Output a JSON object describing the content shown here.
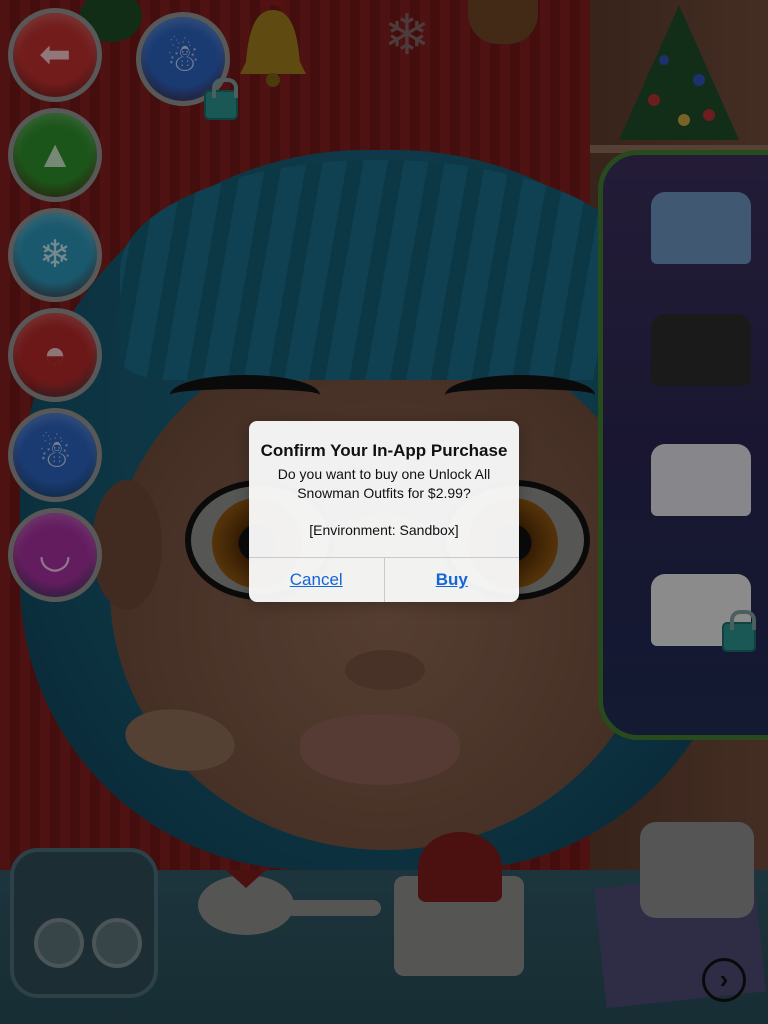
{
  "dialog": {
    "title": "Confirm Your In-App Purchase",
    "message": "Do you want to buy one Unlock All Snowman Outfits for $2.99?",
    "environment": "[Environment: Sandbox]",
    "cancel_label": "Cancel",
    "buy_label": "Buy"
  },
  "menu": {
    "items": [
      {
        "name": "back",
        "icon": "arrow-left-icon",
        "color": "#b8302e"
      },
      {
        "name": "tree",
        "icon": "christmas-tree-icon",
        "color": "#2e8a2a"
      },
      {
        "name": "snowflake",
        "icon": "snowflake-icon",
        "color": "#2a8fb0"
      },
      {
        "name": "santa-hat",
        "icon": "santa-hat-icon",
        "color": "#b02828"
      },
      {
        "name": "snowman",
        "icon": "snowman-icon",
        "color": "#2a5fb8"
      },
      {
        "name": "lips",
        "icon": "lips-icon",
        "color": "#a0309a"
      }
    ],
    "top_snowman": {
      "icon": "snowman-icon",
      "color": "#2a5fb8",
      "locked": true
    }
  },
  "wardrobe": {
    "outfits": [
      {
        "name": "blue-sweater-top-hat",
        "color": "#6a8fb8",
        "locked": false
      },
      {
        "name": "dark-coat",
        "color": "#2a2a2a",
        "locked": false
      },
      {
        "name": "white-scarf-shirt",
        "color": "#d8d8e0",
        "locked": false
      },
      {
        "name": "snowman-shirt",
        "color": "#e0e0e0",
        "locked": true
      }
    ]
  },
  "next_button_icon": "chevron-right-icon"
}
